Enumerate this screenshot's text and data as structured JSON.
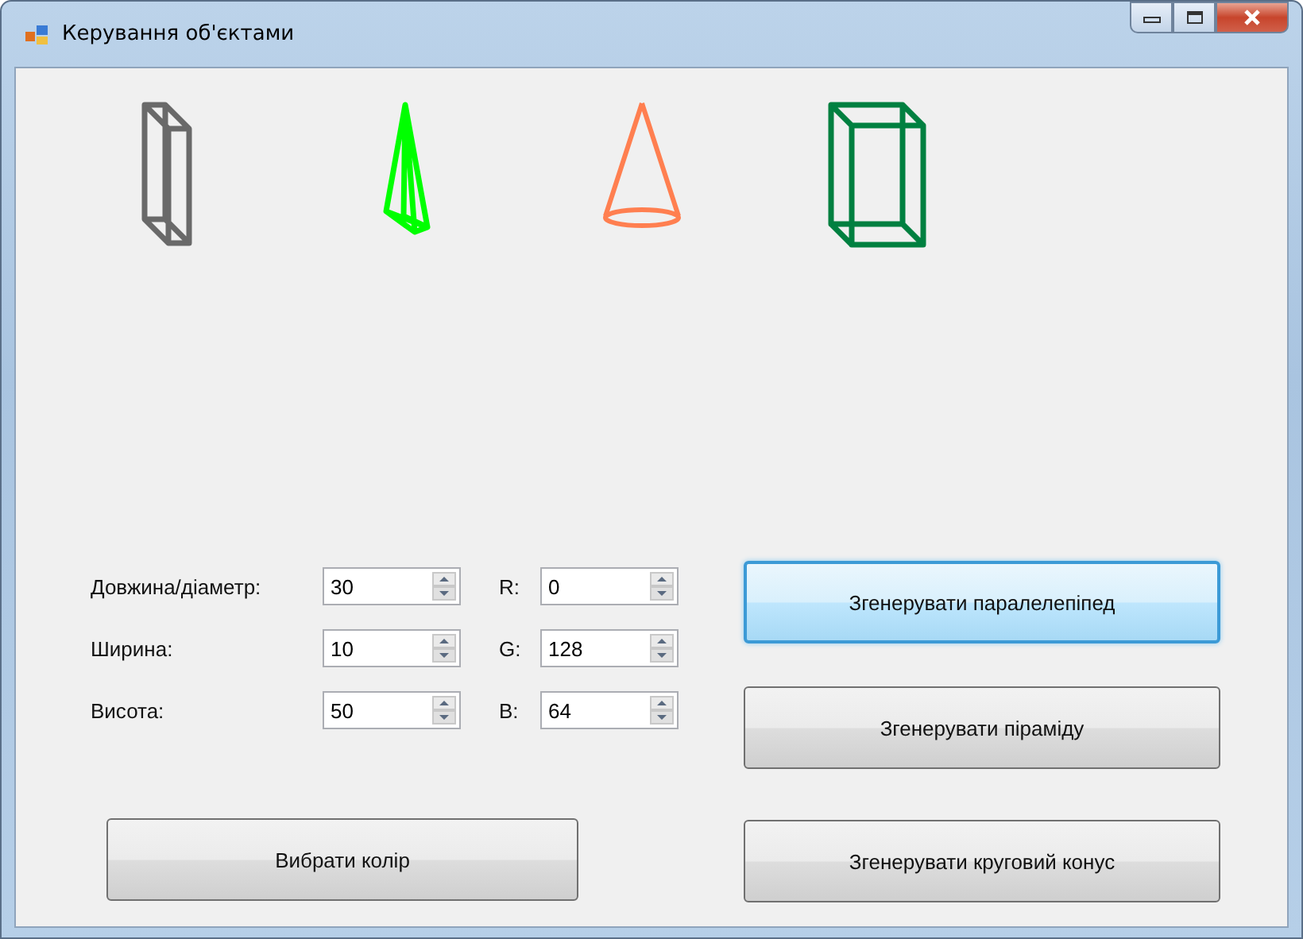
{
  "window": {
    "title": "Керування об'єктами"
  },
  "shapes": [
    {
      "kind": "prism",
      "color": "#696969"
    },
    {
      "kind": "pyramid",
      "color": "#00ff00"
    },
    {
      "kind": "cone",
      "color": "#ff7f50"
    },
    {
      "kind": "box",
      "color": "#008040"
    }
  ],
  "size_fields": [
    {
      "label": "Довжина/діаметр:",
      "value": "30"
    },
    {
      "label": "Ширина:",
      "value": "10"
    },
    {
      "label": "Висота:",
      "value": "50"
    }
  ],
  "color_fields": [
    {
      "label": "R:",
      "value": "0"
    },
    {
      "label": "G:",
      "value": "128"
    },
    {
      "label": "B:",
      "value": "64"
    }
  ],
  "color_button": {
    "label": "Вибрати колір",
    "focused": false
  },
  "generate_buttons": [
    {
      "label": "Згенерувати паралелепіпед",
      "focused": true
    },
    {
      "label": "Згенерувати піраміду",
      "focused": false
    },
    {
      "label": "Згенерувати круговий конус",
      "focused": false
    }
  ]
}
